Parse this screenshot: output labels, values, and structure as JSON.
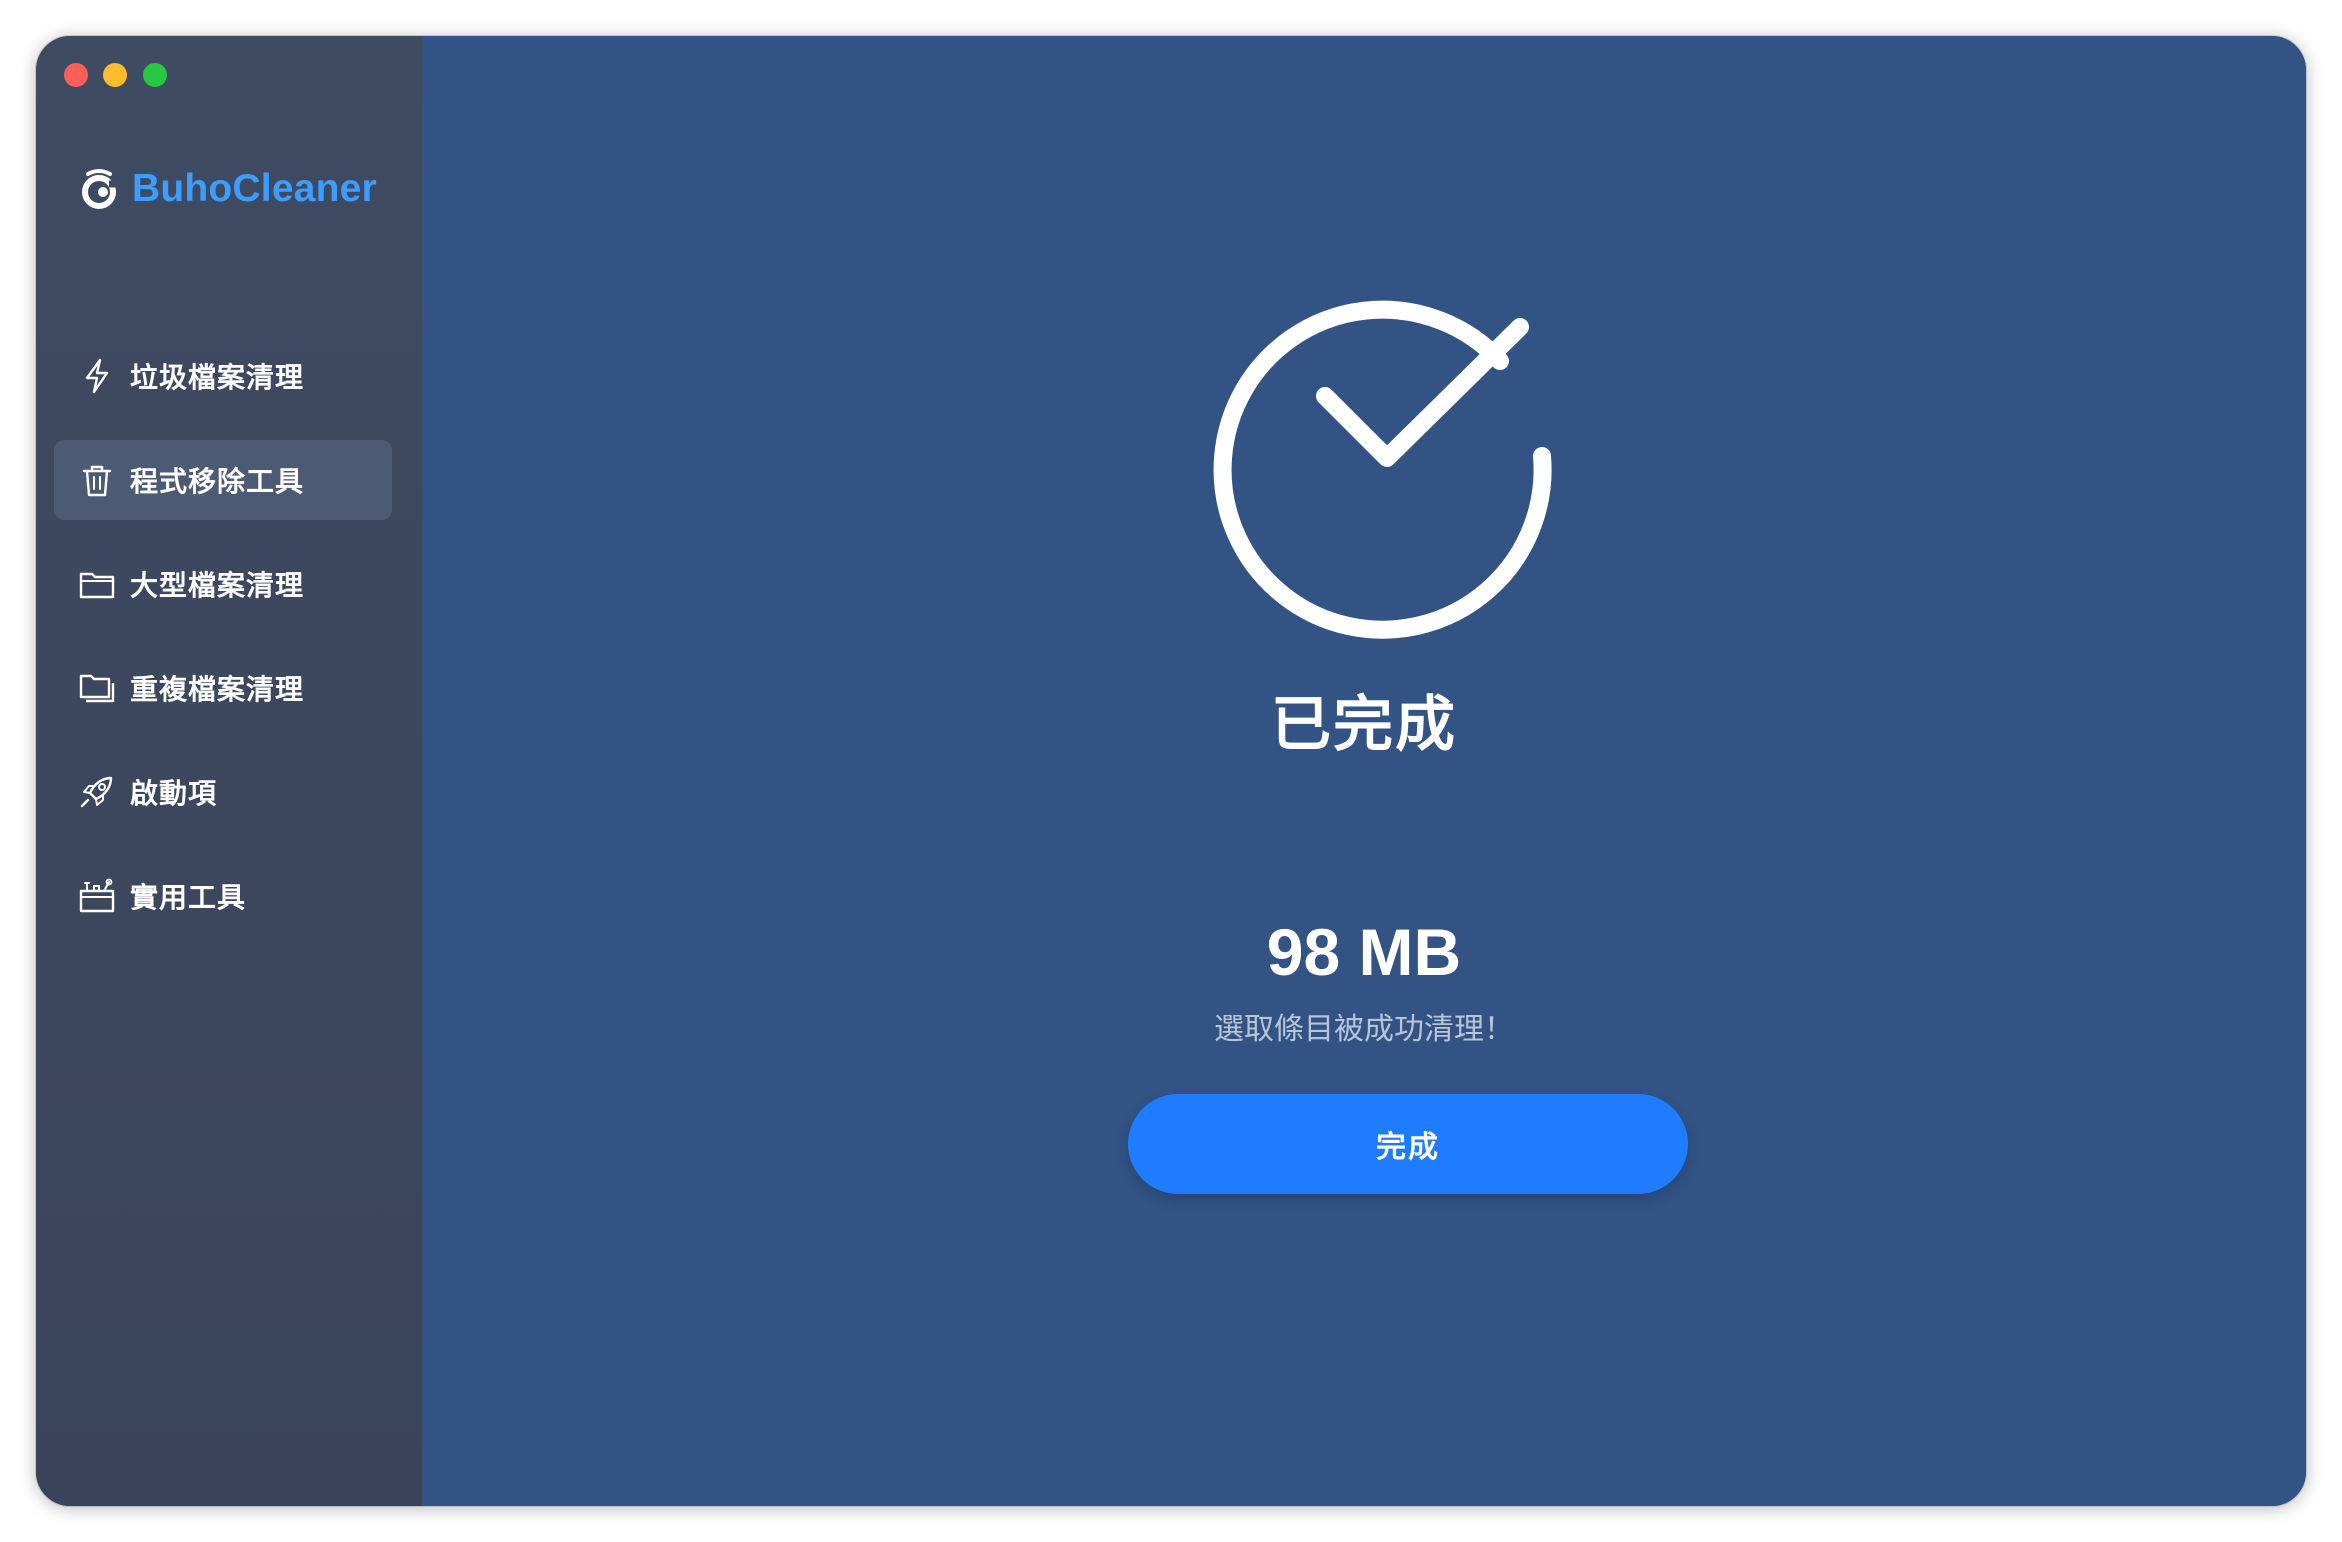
{
  "app": {
    "name": "BuhoCleaner",
    "brand_color": "#3d9cff",
    "logo_icon": "owl-logo-icon"
  },
  "window_controls": {
    "close_color": "#fe5f57",
    "minimize_color": "#febc2e",
    "maximize_color": "#28c840"
  },
  "sidebar": {
    "items": [
      {
        "label": "垃圾檔案清理",
        "icon": "lightning-icon",
        "active": false
      },
      {
        "label": "程式移除工具",
        "icon": "trash-icon",
        "active": true
      },
      {
        "label": "大型檔案清理",
        "icon": "folder-icon",
        "active": false
      },
      {
        "label": "重複檔案清理",
        "icon": "duplicate-folder-icon",
        "active": false
      },
      {
        "label": "啟動項",
        "icon": "rocket-icon",
        "active": false
      },
      {
        "label": "實用工具",
        "icon": "toolbox-icon",
        "active": false
      }
    ]
  },
  "main": {
    "status_icon": "check-circle-icon",
    "status_title": "已完成",
    "cleaned_size": "98 MB",
    "message": "選取條目被成功清理！",
    "done_button": "完成",
    "button_color": "#1f7cff",
    "background_color": "#325384"
  }
}
